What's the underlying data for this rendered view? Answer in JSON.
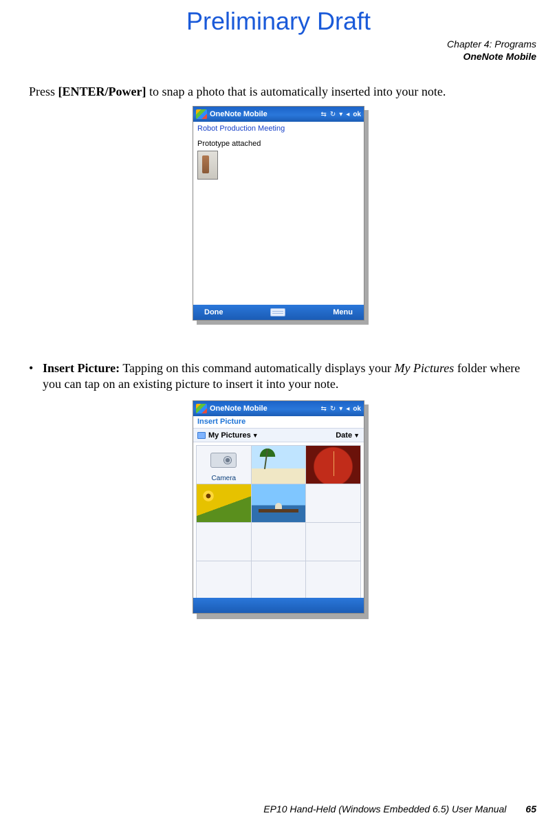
{
  "draft_title": "Preliminary Draft",
  "chapter": {
    "line1": "Chapter 4: Programs",
    "line2": "OneNote Mobile"
  },
  "press_line": {
    "pre": "Press ",
    "key": "[ENTER/Power]",
    "post": " to snap a photo that is automatically inserted into your note."
  },
  "screenshot1": {
    "app_title": "OneNote Mobile",
    "ok": "ok",
    "note_title": "Robot Production Meeting",
    "note_line": "Prototype attached",
    "soft_left": "Done",
    "soft_right": "Menu"
  },
  "insert_block": {
    "bullet": "•",
    "label": "Insert Picture:",
    "text1": " Tapping on this command automatically displays your ",
    "italic": "My Pictures",
    "text2": " folder where you can tap on an existing picture to insert it into your note."
  },
  "screenshot2": {
    "app_title": "OneNote Mobile",
    "ok": "ok",
    "section": "Insert Picture",
    "folder": "My Pictures",
    "sort": "Date",
    "camera_label": "Camera"
  },
  "footer": {
    "manual": "EP10 Hand-Held (Windows Embedded 6.5) User Manual",
    "page": "65"
  }
}
